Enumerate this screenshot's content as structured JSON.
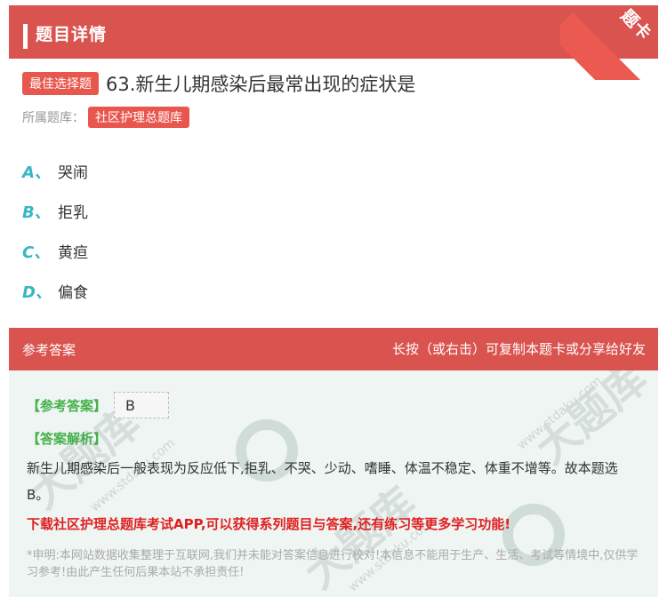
{
  "header": {
    "title": "题目详情",
    "ribbon": "题卡"
  },
  "question": {
    "badge": "最佳选择题",
    "text": "63.新生儿期感染后最常出现的症状是",
    "bank_label": "所属题库：",
    "bank_name": "社区护理总题库"
  },
  "options": [
    {
      "letter": "A、",
      "text": "哭闹"
    },
    {
      "letter": "B、",
      "text": "拒乳"
    },
    {
      "letter": "C、",
      "text": "黄疸"
    },
    {
      "letter": "D、",
      "text": "偏食"
    }
  ],
  "answer_header": {
    "left": "参考答案",
    "right": "长按（或右击）可复制本题卡或分享给好友"
  },
  "answer": {
    "ref_label": "【参考答案】",
    "ref_value": "B",
    "exp_label": "【答案解析】",
    "explanation": "新生儿期感染后一般表现为反应低下,拒乳、不哭、少动、嗜睡、体温不稳定、体重不增等。故本题选B。",
    "promo": "下载社区护理总题库考试APP,可以获得系列题目与答案,还有练习等更多学习功能!",
    "disclaimer": "*申明:本网站数据收集整理于互联网,我们并未能对答案信息进行校对!本信息不能用于生产、生活、考试等情境中,仅供学习参考!由此产生任何后果本站不承担责任!"
  },
  "watermark": {
    "brand": "大题库",
    "domain": "www.stdaku.com"
  },
  "colors": {
    "header": "#d9534f",
    "accent_green": "#46b04a",
    "option_letter": "#39b6c5",
    "promo": "#e02020"
  }
}
